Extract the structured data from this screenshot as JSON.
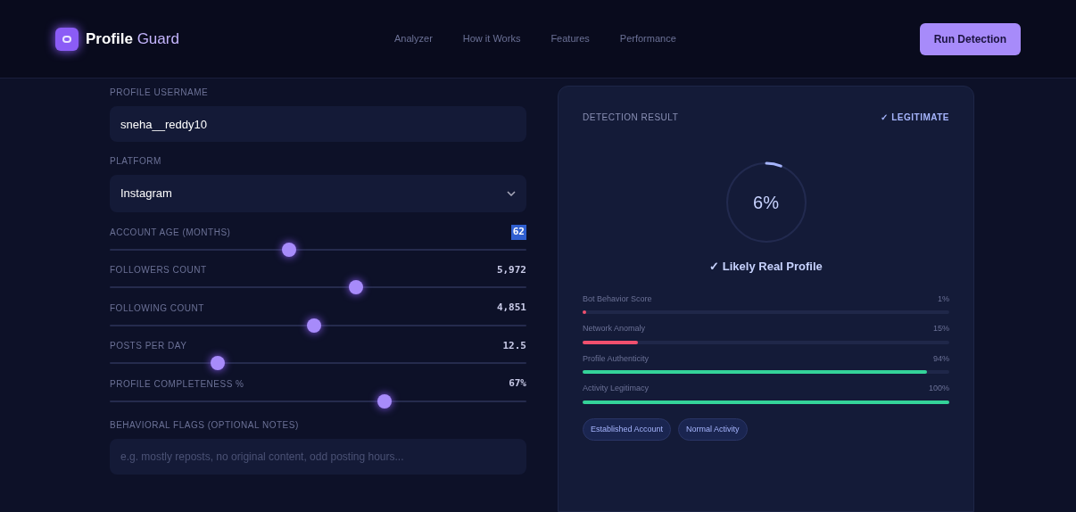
{
  "brand": {
    "name": "Profile",
    "accent": "Guard"
  },
  "nav": [
    {
      "label": "Analyzer"
    },
    {
      "label": "How it Works"
    },
    {
      "label": "Features"
    },
    {
      "label": "Performance"
    }
  ],
  "run_button": "Run Detection",
  "form": {
    "username": {
      "label": "PROFILE USERNAME",
      "value": "sneha__reddy10"
    },
    "platform": {
      "label": "PLATFORM",
      "value": "Instagram"
    },
    "sliders": [
      {
        "label": "ACCOUNT AGE (MONTHS)",
        "reading": "62",
        "highlighted": true,
        "level": 0.43
      },
      {
        "label": "FOLLOWERS COUNT",
        "reading": "5,972",
        "highlighted": false,
        "level": 0.59
      },
      {
        "label": "FOLLOWING COUNT",
        "reading": "4,851",
        "highlighted": false,
        "level": 0.49
      },
      {
        "label": "POSTS PER DAY",
        "reading": "12.5",
        "highlighted": false,
        "level": 0.26
      },
      {
        "label": "PROFILE COMPLETENESS %",
        "reading": "67%",
        "highlighted": false,
        "level": 0.66
      }
    ],
    "notes": {
      "label": "BEHAVIORAL FLAGS (OPTIONAL NOTES)",
      "placeholder": "e.g. mostly reposts, no original content, odd posting hours..."
    }
  },
  "result": {
    "title": "DETECTION RESULT",
    "verdict_badge": "✓ LEGITIMATE",
    "score": "6%",
    "verdict": "✓ Likely Real Profile",
    "metrics": [
      {
        "label": "Bot Behavior Score",
        "reading": "1%",
        "level": 0.01,
        "color": "#f0506e"
      },
      {
        "label": "Network Anomaly",
        "reading": "15%",
        "level": 0.15,
        "color": "#f0506e"
      },
      {
        "label": "Profile Authenticity",
        "reading": "94%",
        "level": 0.94,
        "color": "#34d399"
      },
      {
        "label": "Activity Legitimacy",
        "reading": "100%",
        "level": 1.0,
        "color": "#34d399"
      }
    ],
    "tags": [
      {
        "label": "Established Account"
      },
      {
        "label": "Normal Activity"
      }
    ]
  }
}
